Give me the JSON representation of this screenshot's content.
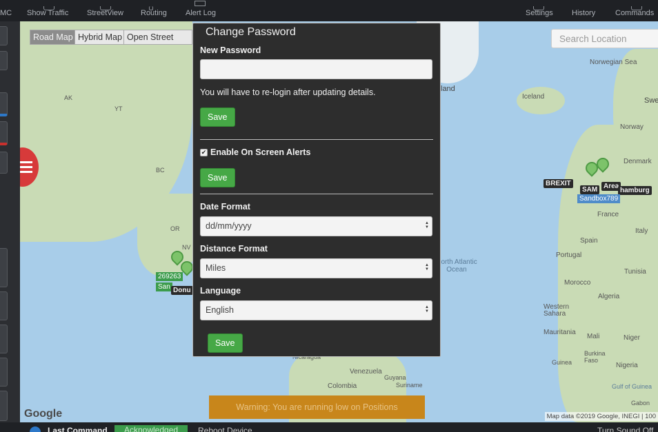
{
  "topnav": {
    "left_cut": "MC",
    "items": [
      "Show Traffic",
      "StreetView",
      "Routing",
      "Alert Log"
    ],
    "right_items": [
      "Settings",
      "History",
      "Commands"
    ]
  },
  "map": {
    "types": [
      "Road Map",
      "Hybrid Map",
      "Open Street Map"
    ],
    "search_placeholder": "Search Location",
    "labels": [
      "Norwegian Sea",
      "Iceland",
      "Norway",
      "Denmark",
      "France",
      "Spain",
      "Italy",
      "Portugal",
      "Morocco",
      "Algeria",
      "Tunisia",
      "Western Sahara",
      "Mauritania",
      "Mali",
      "Niger",
      "Burkina Faso",
      "Nigeria",
      "Guinea",
      "Gulf of Guinea",
      "Gabon",
      "Venezuela",
      "Colombia",
      "Guyana",
      "Suriname",
      "Nicaragua",
      "AK",
      "YT",
      "BC",
      "OR",
      "NV",
      "land",
      "Swe"
    ],
    "ocean": "North Atlantic Ocean",
    "markers": [
      "BREXIT",
      "SAM",
      "Area",
      "hamburg",
      "Sandbox789",
      "269263",
      "San",
      "Donu"
    ],
    "copyright": "Map data ©2019 Google, INEGI",
    "scale_cut": "100",
    "google": "Google"
  },
  "warning": "Warning: You are running low on Positions",
  "bottom": {
    "label": "Last Command",
    "status": "Acknowledged",
    "command": "Reboot Device",
    "right": "Turn Sound Off"
  },
  "modal": {
    "title": "Change Password",
    "new_password_label": "New Password",
    "new_password_value": "",
    "relogin_note": "You will have to re-login after updating details.",
    "save_label": "Save",
    "alerts_label": "Enable On Screen Alerts",
    "alerts_checked": true,
    "date_format_label": "Date Format",
    "date_format_value": "dd/mm/yyyy",
    "distance_format_label": "Distance Format",
    "distance_format_value": "Miles",
    "language_label": "Language",
    "language_value": "English"
  },
  "colors": {
    "accent_green": "#46a846",
    "warning": "#c8861b",
    "menu_red": "#d73a3a"
  }
}
